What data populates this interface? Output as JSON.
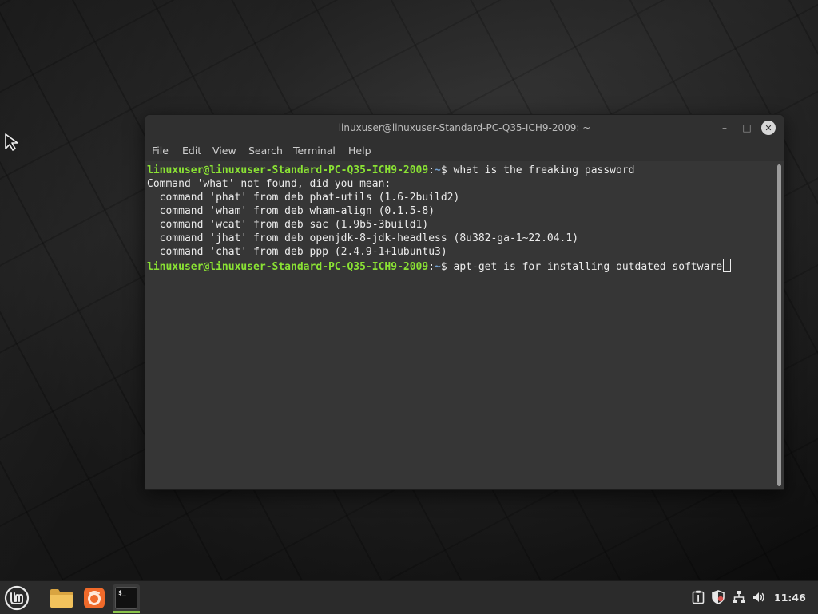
{
  "desktop": {
    "background_color": "#1f1f1f"
  },
  "window": {
    "title": "linuxuser@linuxuser-Standard-PC-Q35-ICH9-2009: ~",
    "minimize_glyph": "–",
    "maximize_glyph": "□",
    "close_glyph": "✕"
  },
  "menu": {
    "file": "File",
    "edit": "Edit",
    "view": "View",
    "search": "Search",
    "terminal": "Terminal",
    "help": "Help"
  },
  "terminal": {
    "colors": {
      "prompt_user": "#8ae234",
      "prompt_path": "#729fcf",
      "text": "#ececec",
      "background": "#363636"
    },
    "prompt_user": "linuxuser@linuxuser-Standard-PC-Q35-ICH9-2009",
    "prompt_sep": ":",
    "prompt_path": "~",
    "prompt_symbol": "$ ",
    "lines": [
      {
        "type": "command",
        "text": "what is the freaking password"
      },
      {
        "type": "output",
        "text": "Command 'what' not found, did you mean:"
      },
      {
        "type": "output",
        "text": "  command 'phat' from deb phat-utils (1.6-2build2)"
      },
      {
        "type": "output",
        "text": "  command 'wham' from deb wham-align (0.1.5-8)"
      },
      {
        "type": "output",
        "text": "  command 'wcat' from deb sac (1.9b5-3build1)"
      },
      {
        "type": "output",
        "text": "  command 'jhat' from deb openjdk-8-jdk-headless (8u382-ga-1~22.04.1)"
      },
      {
        "type": "output",
        "text": "  command 'chat' from deb ppp (2.4.9-1+1ubuntu3)"
      },
      {
        "type": "command",
        "text": "apt-get is for installing outdated software",
        "has_cursor": true
      }
    ]
  },
  "taskbar": {
    "menu_icon": "linux-mint-logo-icon",
    "launchers": [
      "folder-icon",
      "firefox-icon",
      "terminal-icon"
    ],
    "terminal_launcher_glyph": "$_",
    "tray": [
      "updates-icon",
      "shield-icon",
      "network-icon",
      "volume-icon"
    ],
    "clock": "11:46",
    "accent_color": "#8ac34a"
  }
}
